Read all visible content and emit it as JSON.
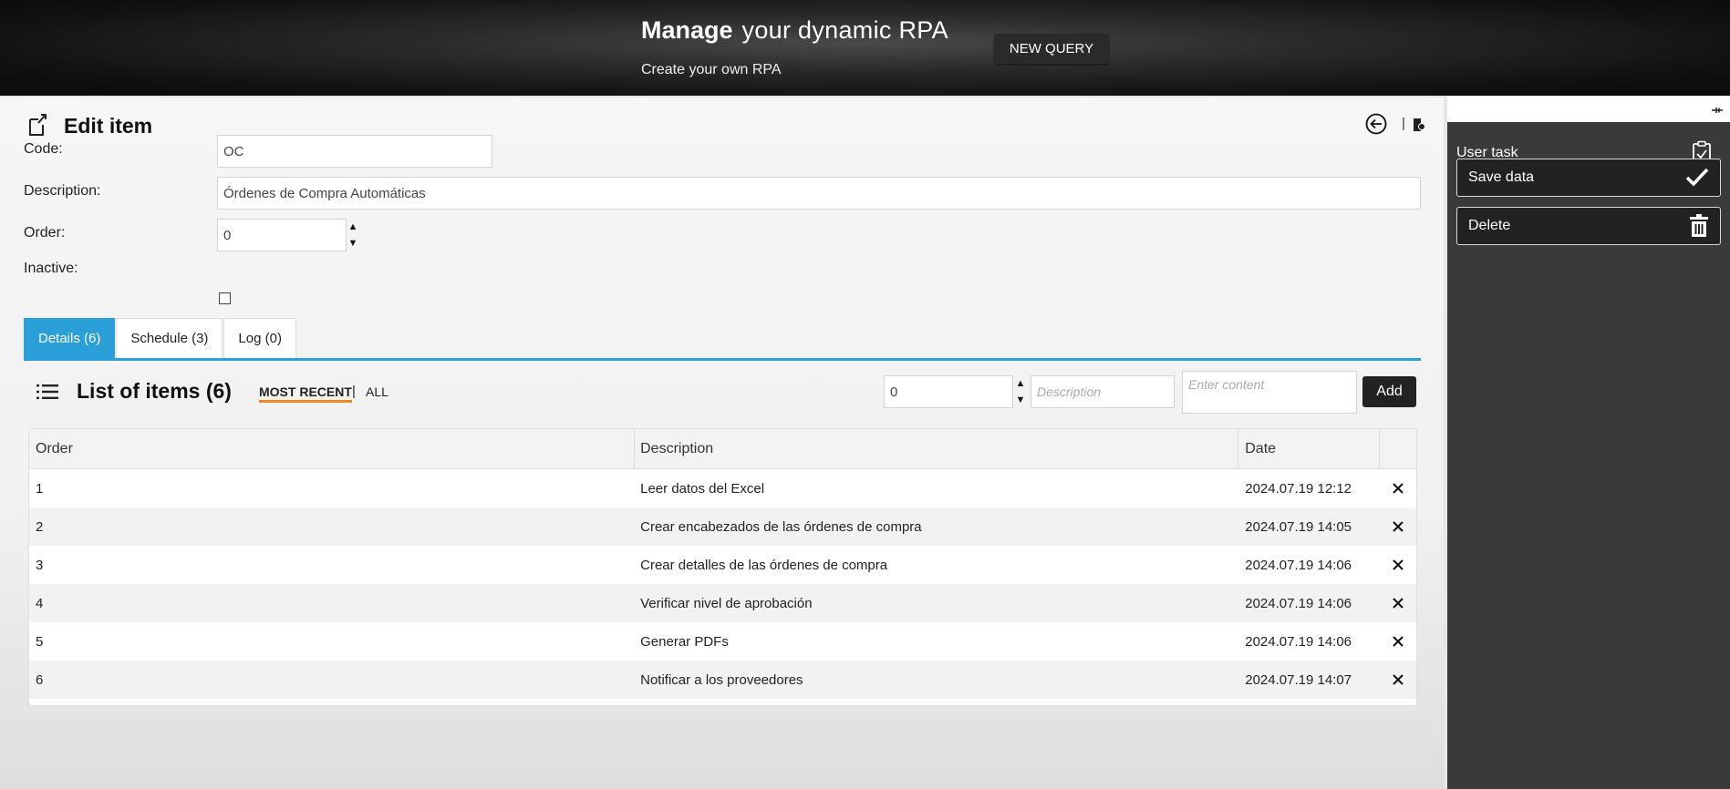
{
  "header": {
    "brand_bold": "Manage",
    "brand_rest": "your dynamic RPA",
    "tagline": "Create your own RPA",
    "new_query_label": "NEW QUERY"
  },
  "page": {
    "title": "Edit item"
  },
  "form": {
    "code_label": "Code:",
    "code_value": "OC",
    "description_label": "Description:",
    "description_value": "Órdenes de Compra Automáticas",
    "order_label": "Order:",
    "order_value": "0",
    "inactive_label": "Inactive:",
    "inactive_checked": false
  },
  "tabs": [
    {
      "label": "Details (6)",
      "active": true
    },
    {
      "label": "Schedule (3)",
      "active": false
    },
    {
      "label": "Log (0)",
      "active": false
    }
  ],
  "list": {
    "title": "List of items (6)",
    "filter_recent": "MOST RECENT",
    "filter_sep": "|",
    "filter_all": "ALL",
    "add_order_value": "0",
    "add_description_placeholder": "Description",
    "add_content_placeholder": "Enter content",
    "add_button_label": "Add",
    "columns": [
      "Order",
      "Description",
      "Date"
    ],
    "rows": [
      {
        "order": "1",
        "description": "Leer datos del Excel",
        "date": "2024.07.19 12:12"
      },
      {
        "order": "2",
        "description": "Crear encabezados de las órdenes de compra",
        "date": "2024.07.19 14:05"
      },
      {
        "order": "3",
        "description": "Crear detalles de las órdenes de compra",
        "date": "2024.07.19 14:06"
      },
      {
        "order": "4",
        "description": "Verificar nivel de aprobación",
        "date": "2024.07.19 14:06"
      },
      {
        "order": "5",
        "description": "Generar PDFs",
        "date": "2024.07.19 14:06"
      },
      {
        "order": "6",
        "description": "Notificar a los proveedores",
        "date": "2024.07.19 14:07"
      }
    ]
  },
  "sidebar": {
    "user_task_label": "User task",
    "save_label": "Save data",
    "delete_label": "Delete"
  },
  "colors": {
    "accent_blue": "#2a9fd8",
    "accent_orange": "#f08a1c",
    "sidebar_bg": "#3a3a3a"
  }
}
